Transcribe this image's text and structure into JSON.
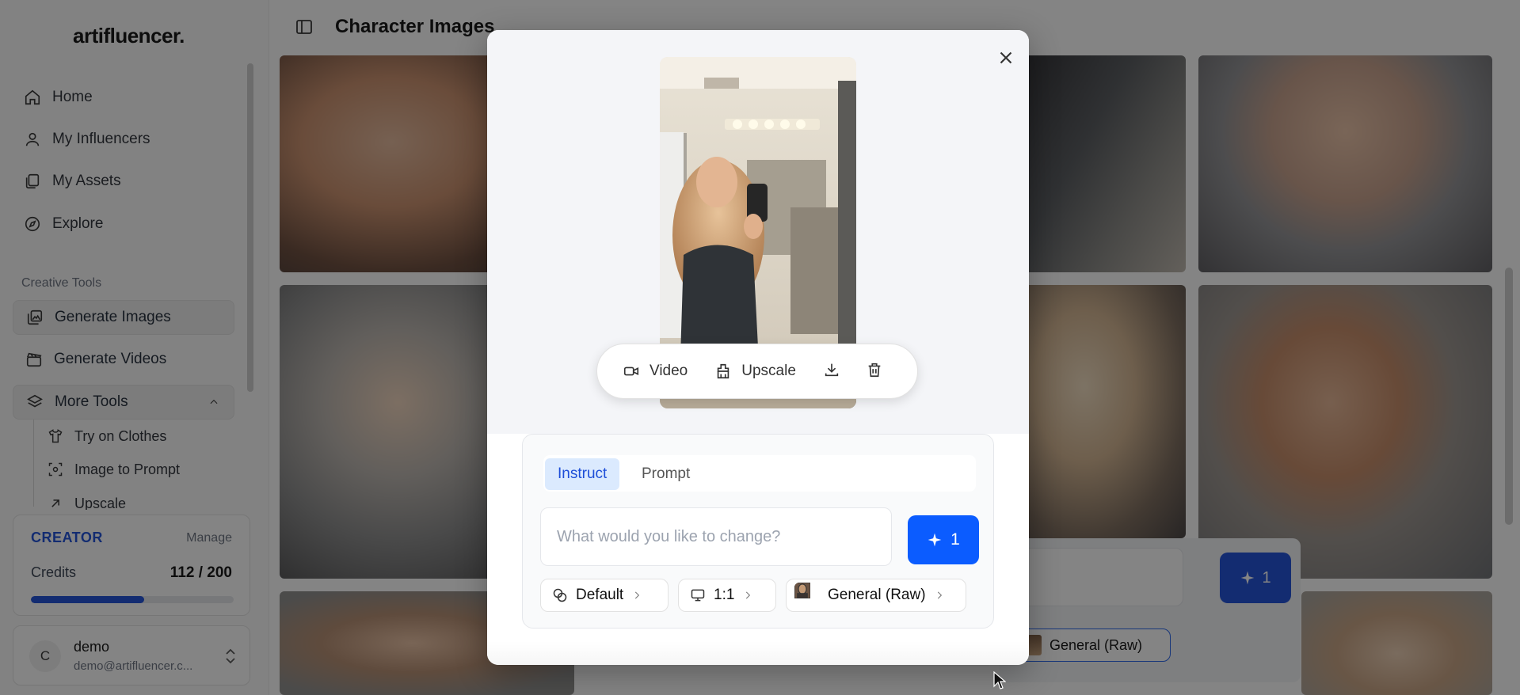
{
  "app": {
    "logo": "artifluencer."
  },
  "sidebar": {
    "nav": [
      {
        "label": "Home",
        "icon": "home-icon"
      },
      {
        "label": "My Influencers",
        "icon": "user-icon"
      },
      {
        "label": "My Assets",
        "icon": "assets-icon"
      },
      {
        "label": "Explore",
        "icon": "compass-icon"
      }
    ],
    "section_label": "Creative Tools",
    "tools": [
      {
        "label": "Generate Images",
        "icon": "images-icon",
        "active": true
      },
      {
        "label": "Generate Videos",
        "icon": "clapperboard-icon"
      },
      {
        "label": "More Tools",
        "icon": "layers-icon",
        "expanded": true
      }
    ],
    "sub_tools": [
      {
        "label": "Try on Clothes",
        "icon": "shirt-icon"
      },
      {
        "label": "Image to Prompt",
        "icon": "scan-icon"
      },
      {
        "label": "Upscale",
        "icon": "arrow-up-right-icon"
      }
    ],
    "plan": {
      "name": "CREATOR",
      "manage_label": "Manage",
      "credits_label": "Credits",
      "credits_value": "112 / 200",
      "credits_used": 112,
      "credits_total": 200
    },
    "user": {
      "initial": "C",
      "name": "demo",
      "email": "demo@artifluencer.c..."
    }
  },
  "main": {
    "title": "Character Images",
    "background_panel": {
      "send_label": "1",
      "chip_label": "General (Raw)"
    }
  },
  "modal": {
    "actions": {
      "video_label": "Video",
      "upscale_label": "Upscale"
    },
    "tabs": [
      {
        "label": "Instruct",
        "active": true
      },
      {
        "label": "Prompt",
        "active": false
      }
    ],
    "input": {
      "placeholder": "What would you like to change?",
      "value": ""
    },
    "generate": {
      "count": "1"
    },
    "chips": {
      "style": "Default",
      "aspect": "1:1",
      "model": "General (Raw)"
    }
  },
  "colors": {
    "accent": "#1d4ed8",
    "primary_button": "#0b5cff",
    "overlay": "rgba(10,10,10,0.5)"
  }
}
